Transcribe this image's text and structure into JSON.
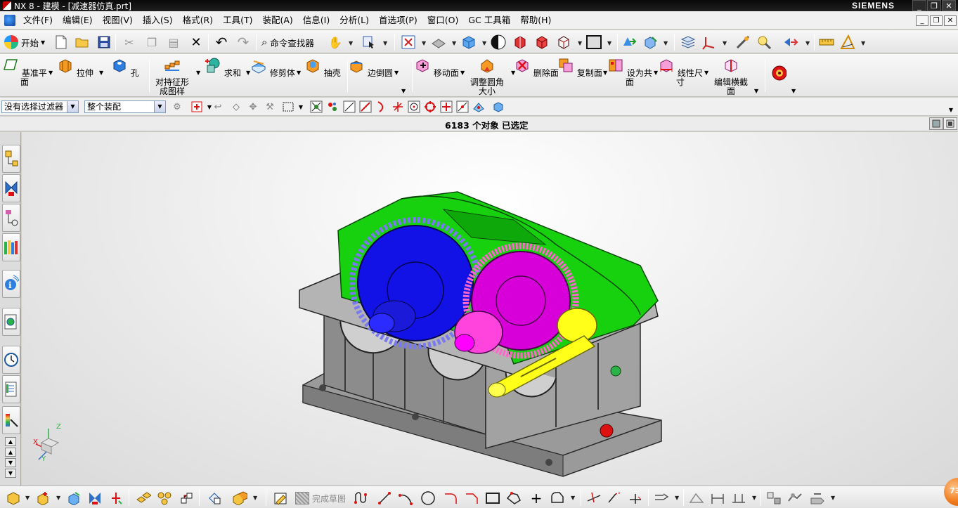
{
  "window": {
    "title": "NX 8 - 建模 - [减速器仿真.prt]",
    "brand": "SIEMENS",
    "controls": [
      "_",
      "❐",
      "✕"
    ],
    "mdi_controls": [
      "_",
      "❐",
      "✕"
    ]
  },
  "menu": {
    "items": [
      "文件(F)",
      "编辑(E)",
      "视图(V)",
      "插入(S)",
      "格式(R)",
      "工具(T)",
      "装配(A)",
      "信息(I)",
      "分析(L)",
      "首选项(P)",
      "窗口(O)",
      "GC 工具箱",
      "帮助(H)"
    ]
  },
  "std_toolbar": {
    "start_label": "开始",
    "command_finder_label": "命令查找器"
  },
  "feature_toolbar": {
    "buttons": [
      {
        "label": "基准平面"
      },
      {
        "label": "拉伸"
      },
      {
        "label": "孔"
      },
      {
        "label": "对持征形成图样"
      },
      {
        "label": "求和"
      },
      {
        "label": "修剪体"
      },
      {
        "label": "抽壳"
      },
      {
        "label": "边倒圆"
      },
      {
        "label": "移动面"
      },
      {
        "label": "调整圆角大小"
      },
      {
        "label": "删除面"
      },
      {
        "label": "复制面"
      },
      {
        "label": "设为共面"
      },
      {
        "label": "线性尺寸"
      },
      {
        "label": "编辑横截面"
      }
    ]
  },
  "selection_bar": {
    "filter_value": "没有选择过滤器",
    "scope_value": "整个装配"
  },
  "status": {
    "message": "6183 个对象 已选定"
  },
  "triad": {
    "x_label": "X",
    "y_label": "Y",
    "z_label": "Z"
  },
  "bottom_toolbar": {
    "finish_sketch_label": "完成草图"
  },
  "badge": {
    "value": "73"
  },
  "colors": {
    "housing_cover": "#17d10f",
    "gear_large": "#1212e6",
    "gear_mid": "#d800d8",
    "gear_small_teeth": "#ff66cc",
    "pinion_shaft": "#ffff1a",
    "housing_base": "#8c8c8c",
    "accent_orange": "#f07a1c"
  }
}
